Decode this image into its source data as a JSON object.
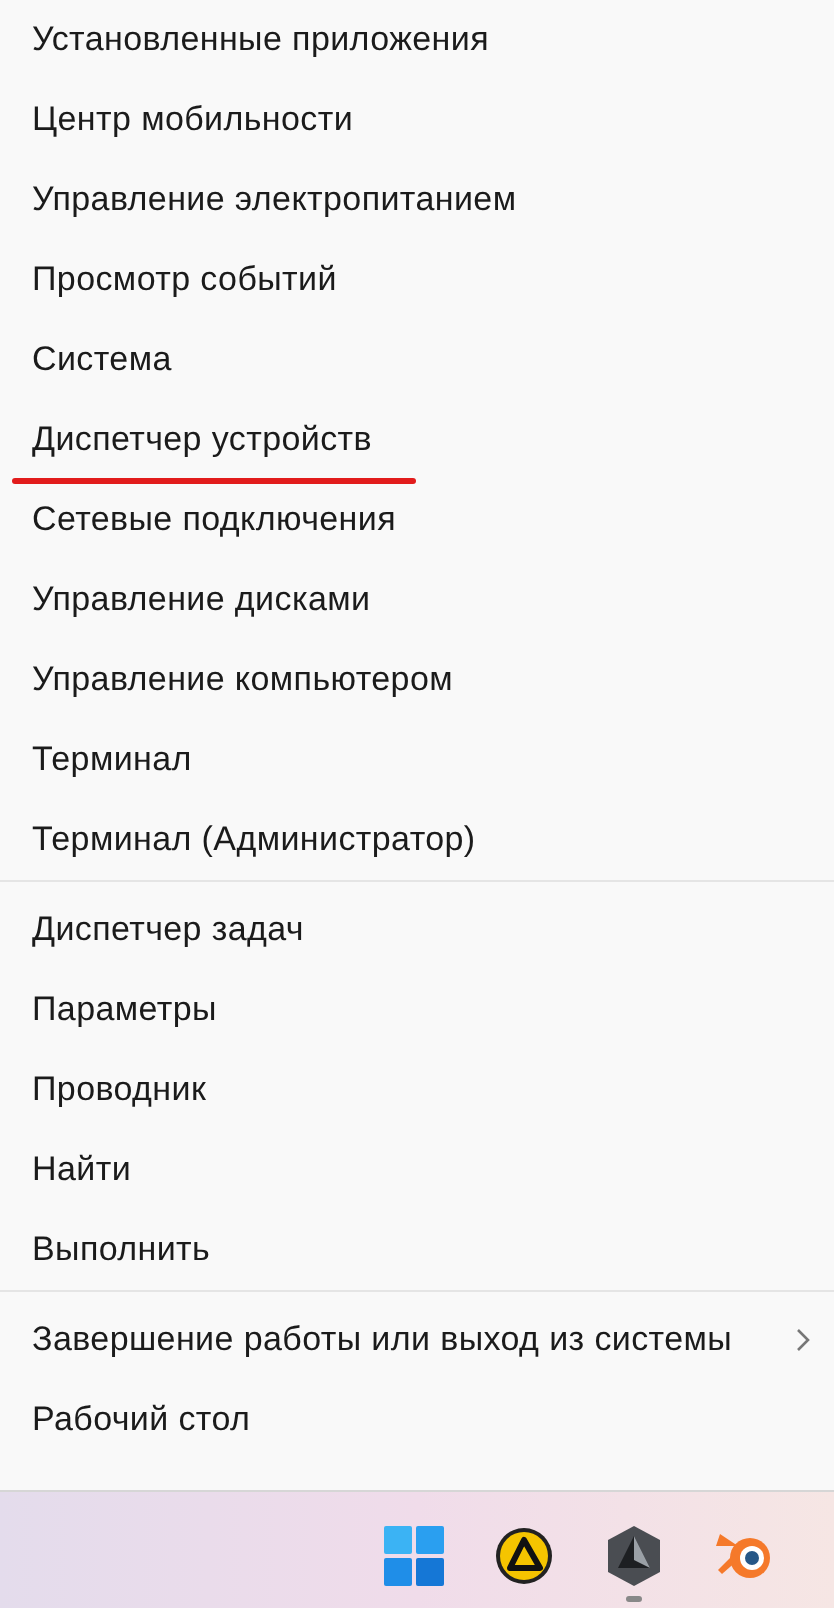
{
  "menu": {
    "groups": [
      {
        "items": [
          {
            "label": "Установленные приложения",
            "underlined": false,
            "submenu": false
          },
          {
            "label": "Центр мобильности",
            "underlined": false,
            "submenu": false
          },
          {
            "label": "Управление электропитанием",
            "underlined": false,
            "submenu": false
          },
          {
            "label": "Просмотр событий",
            "underlined": false,
            "submenu": false
          },
          {
            "label": "Система",
            "underlined": false,
            "submenu": false
          },
          {
            "label": "Диспетчер устройств",
            "underlined": true,
            "submenu": false
          },
          {
            "label": "Сетевые подключения",
            "underlined": false,
            "submenu": false
          },
          {
            "label": "Управление дисками",
            "underlined": false,
            "submenu": false
          },
          {
            "label": "Управление компьютером",
            "underlined": false,
            "submenu": false
          },
          {
            "label": "Терминал",
            "underlined": false,
            "submenu": false
          },
          {
            "label": "Терминал (Администратор)",
            "underlined": false,
            "submenu": false
          }
        ]
      },
      {
        "items": [
          {
            "label": "Диспетчер задач",
            "underlined": false,
            "submenu": false
          },
          {
            "label": "Параметры",
            "underlined": false,
            "submenu": false
          },
          {
            "label": "Проводник",
            "underlined": false,
            "submenu": false
          },
          {
            "label": "Найти",
            "underlined": false,
            "submenu": false
          },
          {
            "label": "Выполнить",
            "underlined": false,
            "submenu": false
          }
        ]
      },
      {
        "items": [
          {
            "label": "Завершение работы или выход из системы",
            "underlined": false,
            "submenu": true
          },
          {
            "label": "Рабочий стол",
            "underlined": false,
            "submenu": false
          }
        ]
      }
    ]
  },
  "taskbar": {
    "apps": [
      {
        "kind": "start",
        "running": false
      },
      {
        "kind": "triangle",
        "running": false
      },
      {
        "kind": "hexagon",
        "running": true
      },
      {
        "kind": "blender",
        "running": false
      }
    ]
  }
}
